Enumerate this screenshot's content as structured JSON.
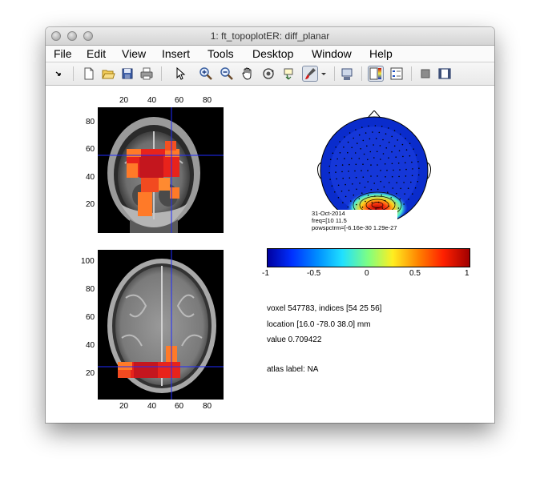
{
  "window": {
    "title": "1: ft_topoplotER: diff_planar"
  },
  "menu": [
    "File",
    "Edit",
    "View",
    "Insert",
    "Tools",
    "Desktop",
    "Window",
    "Help"
  ],
  "toolbar": {
    "buttons": [
      "arrow-small-icon",
      "new-figure-icon",
      "open-icon",
      "save-icon",
      "print-icon",
      "select-pointer-icon",
      "zoom-in-icon",
      "zoom-out-icon",
      "pan-hand-icon",
      "rotate-3d-icon",
      "data-cursor-icon",
      "brush-icon",
      "brush-dropdown-icon",
      "link-plot-icon",
      "colorbar-toggle-icon",
      "legend-toggle-icon",
      "hide-plot-tools-icon",
      "show-plot-tools-icon"
    ]
  },
  "coronal": {
    "xticks": [
      "20",
      "40",
      "60",
      "80"
    ],
    "yticks": [
      "80",
      "60",
      "40",
      "20"
    ]
  },
  "axial": {
    "xticks": [
      "20",
      "40",
      "60",
      "80"
    ],
    "yticks": [
      "100",
      "80",
      "60",
      "40",
      "20"
    ]
  },
  "topo": {
    "annotation_lines": [
      "31-Oct-2014",
      "freq=[10 11.5",
      "powspctrm=[-6.16e-30 1.29e-27"
    ]
  },
  "colorbar": {
    "ticks": [
      "-1",
      "-0.5",
      "0",
      "0.5",
      "1"
    ],
    "range": [
      -1,
      1
    ]
  },
  "info": {
    "voxel": "voxel 547783, indices [54 25 56]",
    "location": "location [16.0 -78.0 38.0] mm",
    "value": "value 0.709422",
    "atlas": "atlas label: NA"
  },
  "colors": {
    "crosshair": "#1f2cff",
    "overlay_red": "#e8231b",
    "overlay_orange": "#ff7a28"
  }
}
